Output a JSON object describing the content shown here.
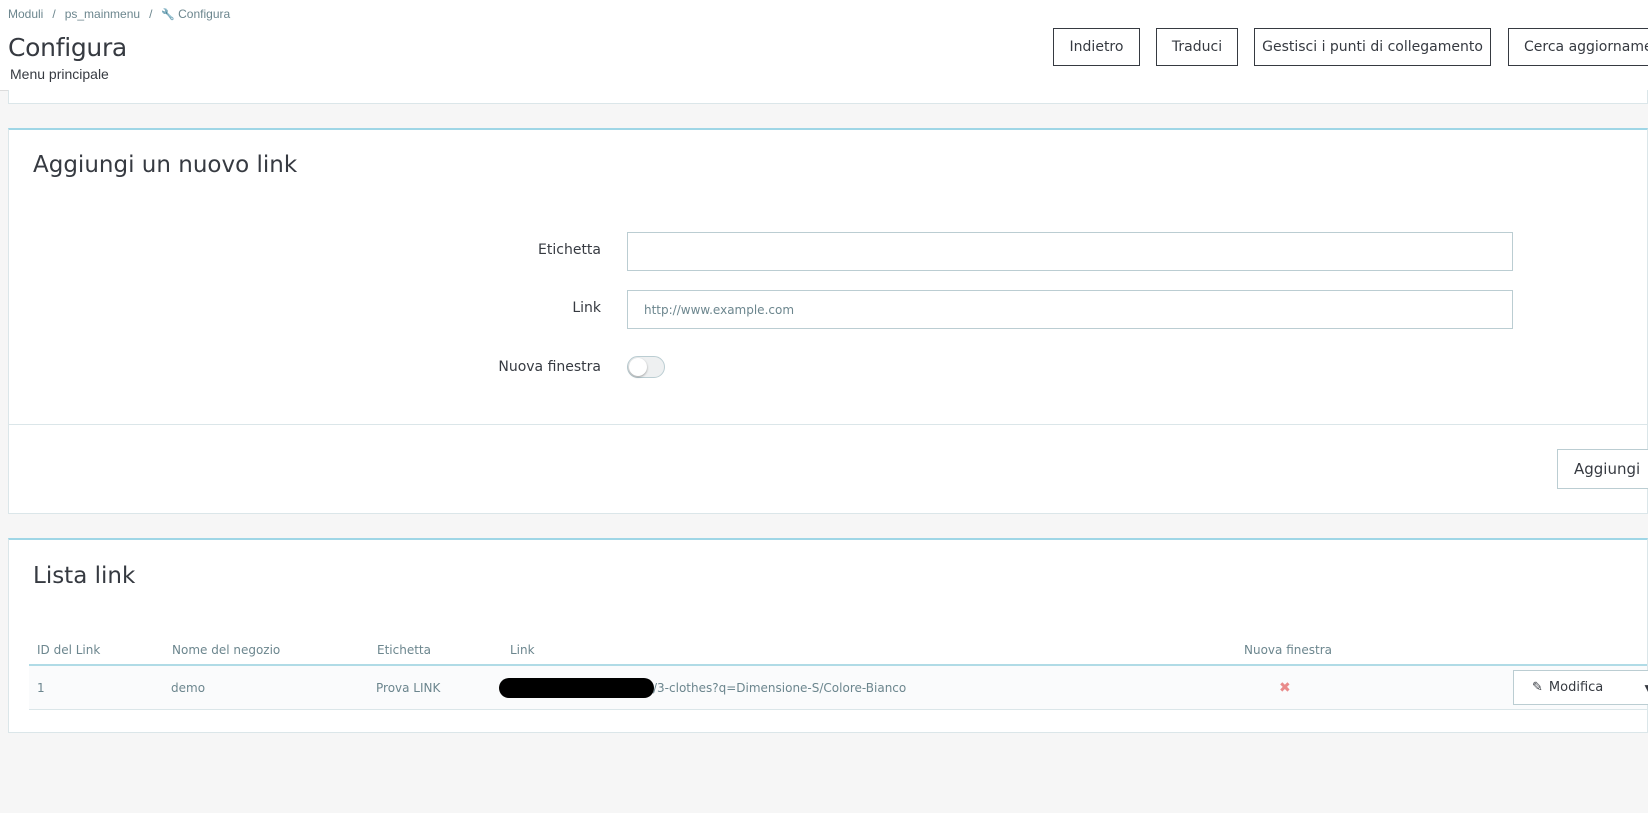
{
  "breadcrumb": {
    "items": [
      "Moduli",
      "ps_mainmenu",
      "Configura"
    ]
  },
  "header": {
    "title": "Configura",
    "subtitle": "Menu principale",
    "buttons": {
      "back": "Indietro",
      "translate": "Traduci",
      "hooks": "Gestisci i punti di collegamento",
      "updates": "Cerca aggiornamenti"
    }
  },
  "add_link_panel": {
    "title": "Aggiungi un nuovo link",
    "label_field": {
      "label": "Etichetta",
      "value": ""
    },
    "link_field": {
      "label": "Link",
      "placeholder": "http://www.example.com"
    },
    "new_window": {
      "label": "Nuova finestra",
      "enabled": false
    },
    "submit_label": "Aggiungi"
  },
  "links_list": {
    "title": "Lista link",
    "columns": [
      "ID del Link",
      "Nome del negozio",
      "Etichetta",
      "Link",
      "Nuova finestra"
    ],
    "rows": [
      {
        "id": "1",
        "shop": "demo",
        "label": "Prova LINK",
        "link_visible": "/3-clothes?q=Dimensione-S/Colore-Bianco",
        "new_window_icon": "✖",
        "edit_label": "Modifica"
      }
    ]
  },
  "colors": {
    "panel_accent": "#9fd6e6",
    "text": "#363a41",
    "muted": "#6c868e",
    "danger_icon": "#e98b8b"
  }
}
